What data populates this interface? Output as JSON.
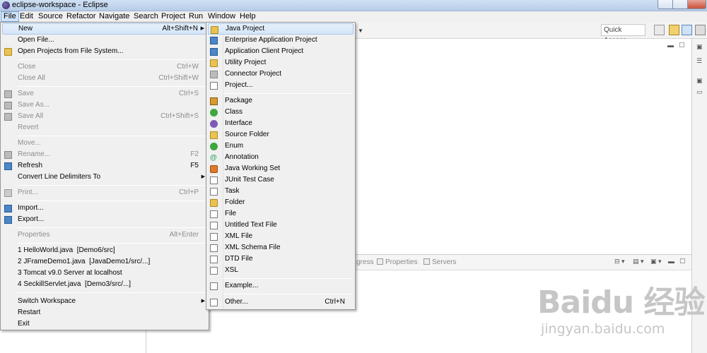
{
  "window": {
    "title": "eclipse-workspace - Eclipse"
  },
  "menubar": [
    "File",
    "Edit",
    "Source",
    "Refactor",
    "Navigate",
    "Search",
    "Project",
    "Run",
    "Window",
    "Help"
  ],
  "toolbar": {
    "quick_access": "Quick Access"
  },
  "file_menu": {
    "new": {
      "label": "New",
      "shortcut": "Alt+Shift+N"
    },
    "open_file": "Open File...",
    "open_projects": "Open Projects from File System...",
    "close": {
      "label": "Close",
      "shortcut": "Ctrl+W"
    },
    "close_all": {
      "label": "Close All",
      "shortcut": "Ctrl+Shift+W"
    },
    "save": {
      "label": "Save",
      "shortcut": "Ctrl+S"
    },
    "save_as": "Save As...",
    "save_all": {
      "label": "Save All",
      "shortcut": "Ctrl+Shift+S"
    },
    "revert": "Revert",
    "move": "Move...",
    "rename": {
      "label": "Rename...",
      "shortcut": "F2"
    },
    "refresh": {
      "label": "Refresh",
      "shortcut": "F5"
    },
    "convert": "Convert Line Delimiters To",
    "print": {
      "label": "Print...",
      "shortcut": "Ctrl+P"
    },
    "import": "Import...",
    "export": "Export...",
    "properties": {
      "label": "Properties",
      "shortcut": "Alt+Enter"
    },
    "recent": [
      "1 HelloWorld.java  [Demo6/src]",
      "2 JFrameDemo1.java  [JavaDemo1/src/...]",
      "3 Tomcat v9.0 Server at localhost",
      "4 SeckillServlet.java  [Demo3/src/...]"
    ],
    "switch_workspace": "Switch Workspace",
    "restart": "Restart",
    "exit": "Exit"
  },
  "new_menu": {
    "java_project": "Java Project",
    "enterprise_app_project": "Enterprise Application Project",
    "app_client_project": "Application Client Project",
    "utility_project": "Utility Project",
    "connector_project": "Connector Project",
    "project": "Project...",
    "package": "Package",
    "class": "Class",
    "interface": "Interface",
    "source_folder": "Source Folder",
    "enum": "Enum",
    "annotation": "Annotation",
    "java_working_set": "Java Working Set",
    "junit_test_case": "JUnit Test Case",
    "task": "Task",
    "folder": "Folder",
    "file": "File",
    "untitled_text_file": "Untitled Text File",
    "xml_file": "XML File",
    "xml_schema_file": "XML Schema File",
    "dtd_file": "DTD File",
    "xsl": "XSL",
    "example": "Example...",
    "other": {
      "label": "Other...",
      "shortcut": "Ctrl+N"
    }
  },
  "bottom_tabs": {
    "progress": "gress",
    "properties": "Properties",
    "servers": "Servers"
  },
  "watermark": {
    "main": "Baidu 经验",
    "sub": "jingyan.baidu.com"
  }
}
